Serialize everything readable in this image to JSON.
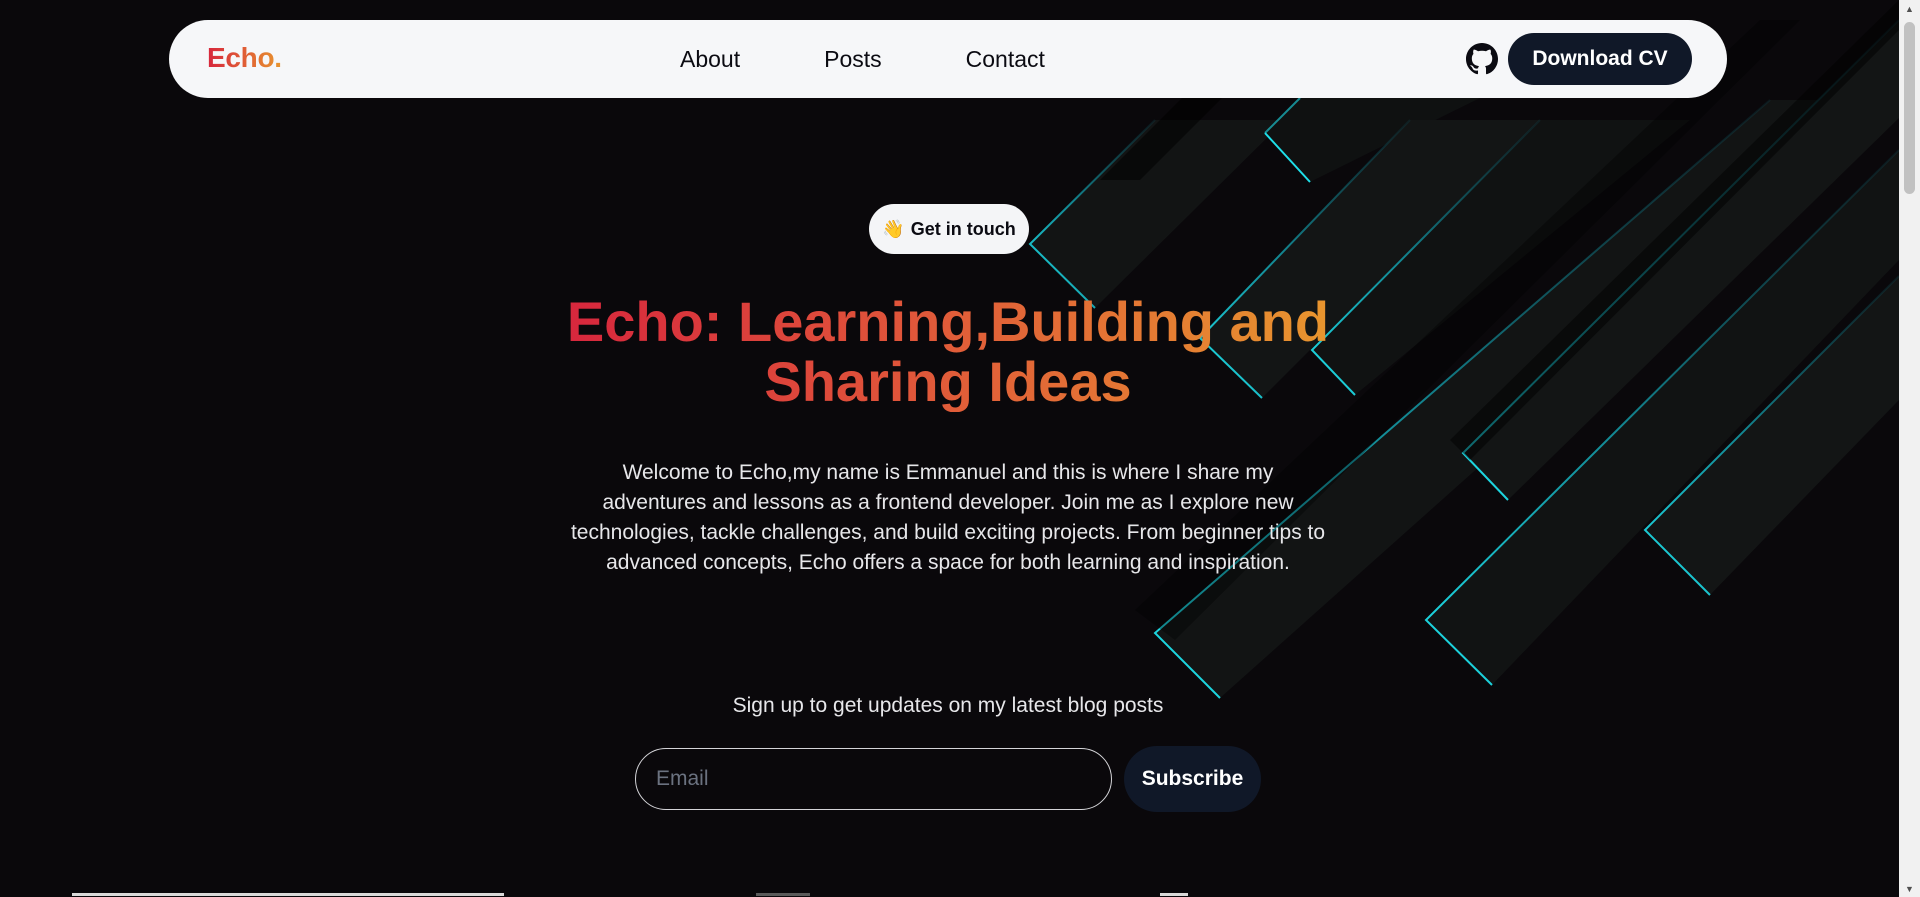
{
  "nav": {
    "logo": "Echo.",
    "links": [
      {
        "label": "About"
      },
      {
        "label": "Posts"
      },
      {
        "label": "Contact"
      }
    ],
    "github_icon": "github-icon",
    "cta_label": "Download CV"
  },
  "hero": {
    "pill_emoji": "👋",
    "pill_label": "Get in touch",
    "title_line1": "Echo: Learning,Building and",
    "title_line2": "Sharing Ideas",
    "description": "Welcome to Echo,my name is Emmanuel and this is where I share my adventures and lessons as a frontend developer. Join me as I explore new technologies, tackle challenges, and build exciting projects. From beginner tips to advanced concepts, Echo offers a space for both learning and inspiration."
  },
  "signup": {
    "label": "Sign up to get updates on my latest blog posts",
    "email_placeholder": "Email",
    "button_label": "Subscribe"
  },
  "colors": {
    "accent_red": "#d7263d",
    "accent_orange": "#e8962e",
    "dark_button": "#101828",
    "background": "#0a080b",
    "neon_cyan": "#16d3e0"
  }
}
